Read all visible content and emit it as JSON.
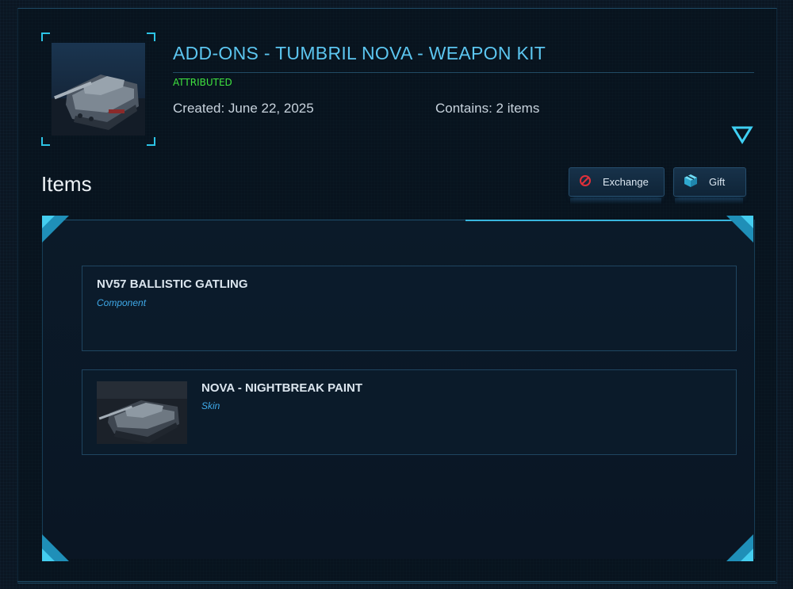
{
  "header": {
    "title": "ADD-ONS - TUMBRIL NOVA - WEAPON KIT",
    "status_badge": "ATTRIBUTED",
    "created": "Created: June 22, 2025",
    "contains": "Contains: 2 items",
    "thumbnail_icon": "tank-vehicle-image",
    "expand_icon": "triangle-down-icon"
  },
  "items_section": {
    "heading": "Items",
    "buttons": {
      "exchange_label": "Exchange",
      "exchange_icon": "no-entry-icon",
      "gift_label": "Gift",
      "gift_icon": "gift-box-icon"
    },
    "items": [
      {
        "name": "NV57 BALLISTIC GATLING",
        "type": "Component",
        "has_image": false
      },
      {
        "name": "NOVA - NIGHTBREAK PAINT",
        "type": "Skin",
        "has_image": true,
        "image_icon": "tank-vehicle-image"
      }
    ]
  },
  "colors": {
    "accent": "#5cc6f0",
    "badge": "#3fe33f",
    "corner": "#2cc4e6",
    "item_type": "#3fa9e8",
    "exchange_icon": "#e0303a",
    "gift_icon": "#3fc4e8"
  }
}
